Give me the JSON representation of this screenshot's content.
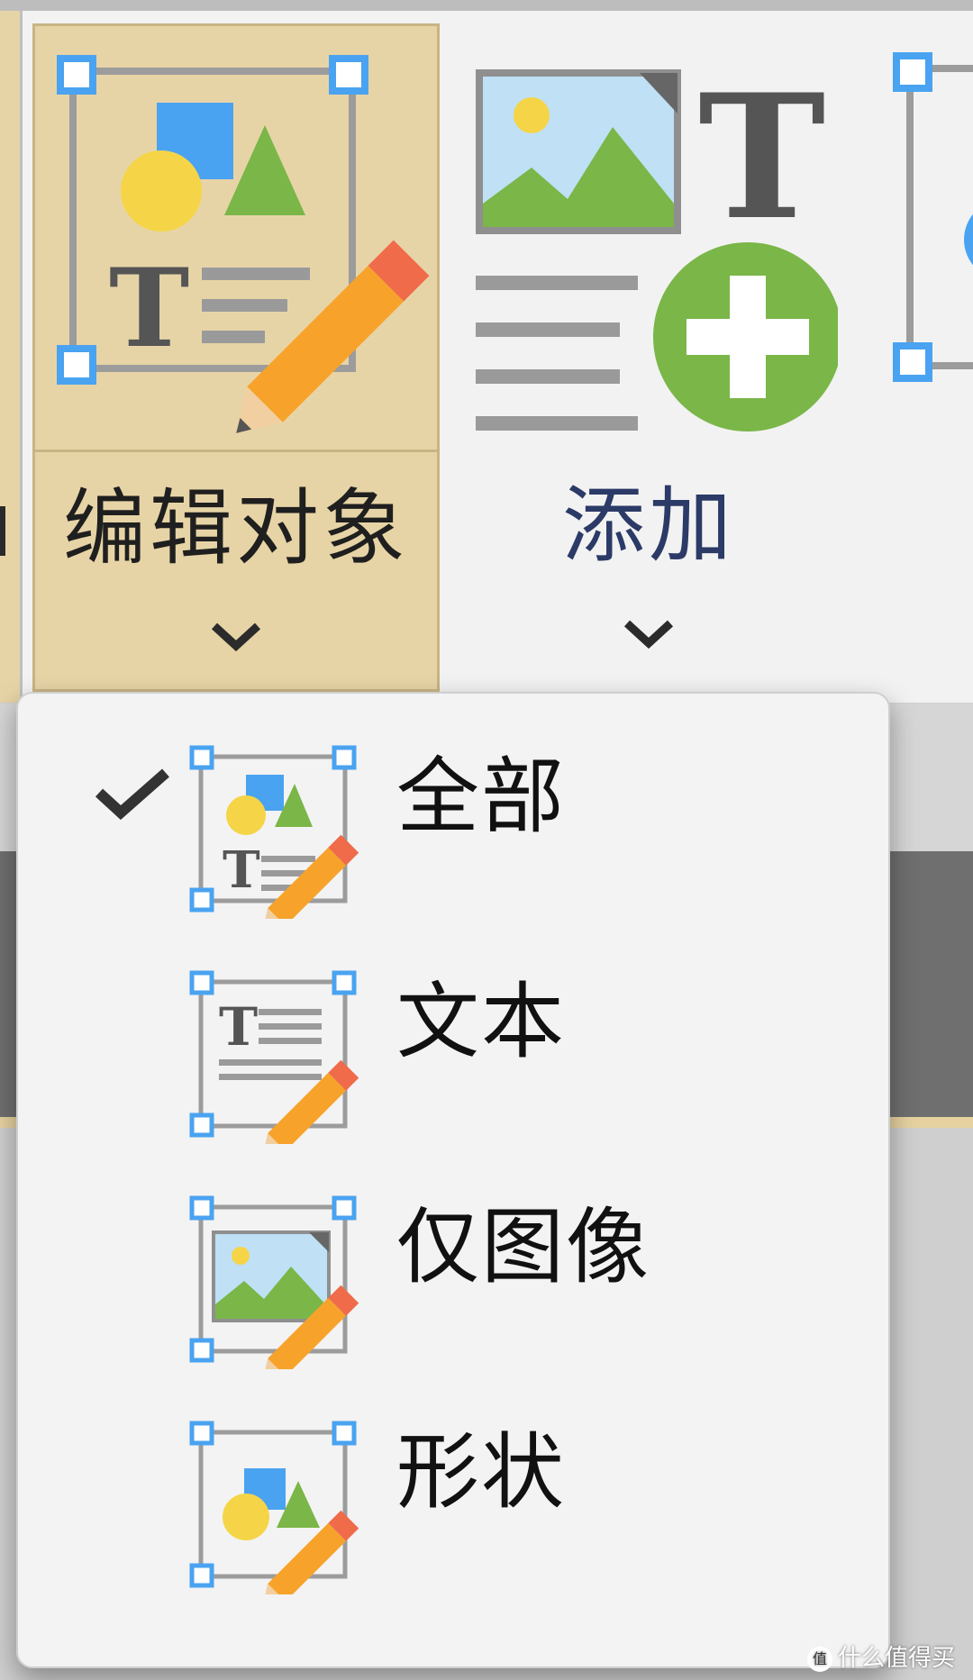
{
  "ribbon": {
    "groups": [
      {
        "id": "edit-objects",
        "label": "编辑对象",
        "icon": "edit-objects-icon",
        "selected": true
      },
      {
        "id": "add",
        "label": "添加",
        "icon": "add-content-icon",
        "selected": false
      }
    ]
  },
  "dropdown": {
    "items": [
      {
        "label": "全部",
        "icon": "edit-all-icon",
        "checked": true
      },
      {
        "label": "文本",
        "icon": "edit-text-icon",
        "checked": false
      },
      {
        "label": "仅图像",
        "icon": "edit-image-icon",
        "checked": false
      },
      {
        "label": "形状",
        "icon": "edit-shape-icon",
        "checked": false
      }
    ]
  },
  "watermark": {
    "text": "值 什么值得买"
  },
  "colors": {
    "selected_group_bg": "#e7d4a6",
    "dropdown_bg": "#f3f3f3",
    "handle_blue": "#4aa3f0",
    "add_green": "#7ab648",
    "pencil_orange": "#f7a32b"
  }
}
